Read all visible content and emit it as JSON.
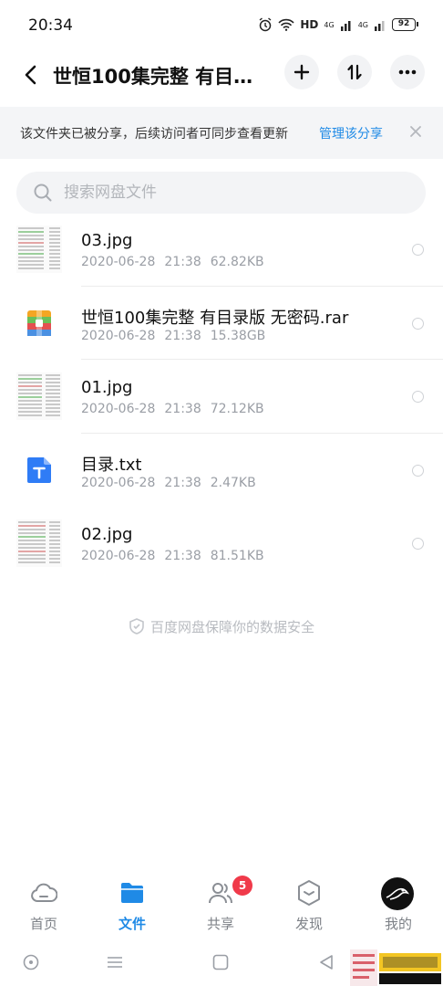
{
  "status_bar": {
    "time": "20:34",
    "hd": "HD",
    "net1": "4G",
    "net2": "4G",
    "battery": "92",
    "icons": [
      "alarm-icon",
      "wifi-icon",
      "signal-icon",
      "battery-icon"
    ]
  },
  "header": {
    "title": "世恒100集完整 有目录…",
    "icons": [
      "back-icon",
      "plus-icon",
      "sort-icon",
      "more-icon"
    ]
  },
  "notice": {
    "text": "该文件夹已被分享，后续访问者可同步查看更新",
    "link": "管理该分享"
  },
  "search": {
    "placeholder": "搜索网盘文件"
  },
  "files": [
    {
      "name": "03.jpg",
      "date": "2020-06-28",
      "time": "21:38",
      "size": "62.82KB",
      "type": "image"
    },
    {
      "name": "世恒100集完整 有目录版 无密码.rar",
      "date": "2020-06-28",
      "time": "21:38",
      "size": "15.38GB",
      "type": "archive"
    },
    {
      "name": "01.jpg",
      "date": "2020-06-28",
      "time": "21:38",
      "size": "72.12KB",
      "type": "image"
    },
    {
      "name": "目录.txt",
      "date": "2020-06-28",
      "time": "21:38",
      "size": "2.47KB",
      "type": "text"
    },
    {
      "name": "02.jpg",
      "date": "2020-06-28",
      "time": "21:38",
      "size": "81.51KB",
      "type": "image"
    }
  ],
  "security_note": "百度网盘保障你的数据安全",
  "tabs": [
    {
      "label": "首页",
      "icon": "cloud-icon"
    },
    {
      "label": "文件",
      "icon": "folder-icon",
      "active": true
    },
    {
      "label": "共享",
      "icon": "people-icon",
      "badge": "5"
    },
    {
      "label": "发现",
      "icon": "discover-icon"
    },
    {
      "label": "我的",
      "icon": "avatar"
    }
  ],
  "colors": {
    "accent": "#1f8ae6",
    "badge": "#f03a4a",
    "muted_text": "#9a9ea5"
  }
}
